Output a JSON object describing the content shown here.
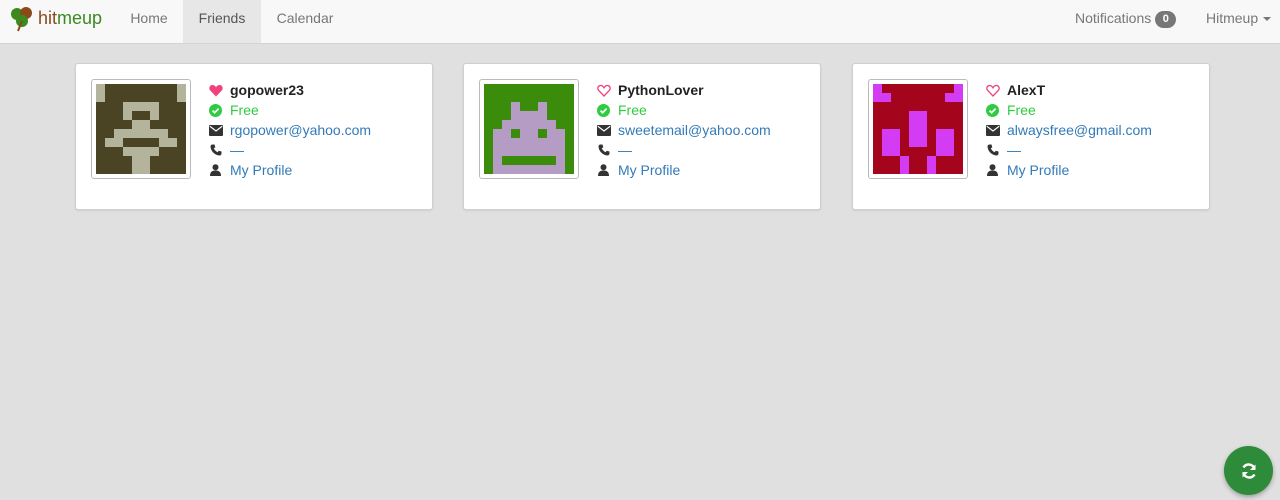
{
  "app": {
    "brand_part1": "hit",
    "brand_part2": "meup"
  },
  "nav": {
    "home": "Home",
    "friends": "Friends",
    "calendar": "Calendar",
    "notifications_label": "Notifications",
    "notifications_count": "0",
    "user_menu": "Hitmeup"
  },
  "friends": [
    {
      "name": "gopower23",
      "favorite": true,
      "status": "Free",
      "email": "rgopower@yahoo.com",
      "phone": "—",
      "profile_link": "My Profile",
      "avatar_colors": {
        "bg": "#4a4424",
        "fg": "#b4b49c"
      }
    },
    {
      "name": "PythonLover",
      "favorite": false,
      "status": "Free",
      "email": "sweetemail@yahoo.com",
      "phone": "—",
      "profile_link": "My Profile",
      "avatar_colors": {
        "bg": "#3c8c0c",
        "fg": "#b49cc4"
      }
    },
    {
      "name": "AlexT",
      "favorite": false,
      "status": "Free",
      "email": "alwaysfree@gmail.com",
      "phone": "—",
      "profile_link": "My Profile",
      "avatar_colors": {
        "bg": "#a4041c",
        "fg": "#d43cf4"
      }
    }
  ],
  "icons": {
    "favorite_on": "heart-filled-icon",
    "favorite_off": "heart-outline-icon",
    "status": "check-circle-icon",
    "email": "envelope-icon",
    "phone": "phone-icon",
    "profile": "user-icon",
    "refresh": "refresh-icon"
  },
  "colors": {
    "heart": "#f0427e",
    "free": "#2ecc40",
    "link": "#337ab7",
    "refresh_button": "#2e8b3a"
  }
}
